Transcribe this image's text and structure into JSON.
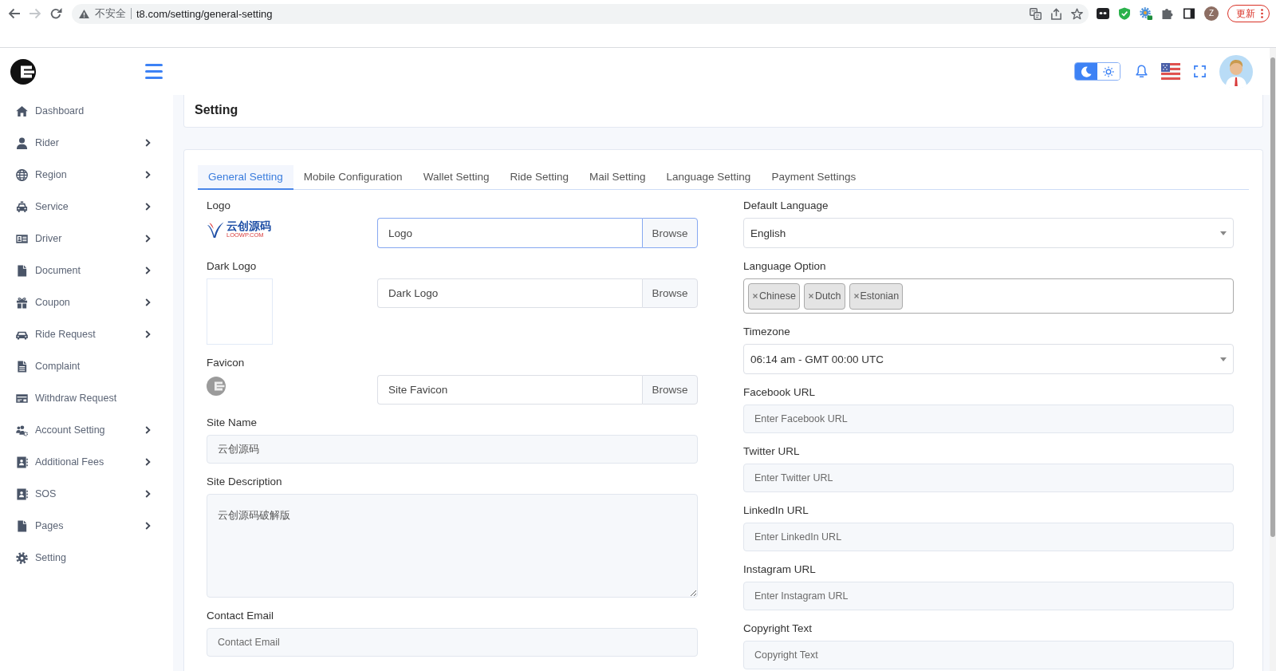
{
  "browser": {
    "nav": [
      {
        "kind": "back",
        "disabled": false
      },
      {
        "kind": "forward",
        "disabled": true
      },
      {
        "kind": "reload",
        "disabled": false
      }
    ],
    "security_label": "不安全",
    "url": "t8.com/setting/general-setting",
    "profile_initial": "Z",
    "update_button": "更新"
  },
  "header": {
    "theme_toggle": [
      {
        "kind": "dark",
        "selected": true
      },
      {
        "kind": "light",
        "selected": false
      }
    ]
  },
  "sidebar": {
    "items": [
      {
        "label": "Dashboard",
        "expandable": false
      },
      {
        "label": "Rider",
        "expandable": true
      },
      {
        "label": "Region",
        "expandable": true
      },
      {
        "label": "Service",
        "expandable": true
      },
      {
        "label": "Driver",
        "expandable": true
      },
      {
        "label": "Document",
        "expandable": true
      },
      {
        "label": "Coupon",
        "expandable": true
      },
      {
        "label": "Ride Request",
        "expandable": true
      },
      {
        "label": "Complaint",
        "expandable": false
      },
      {
        "label": "Withdraw Request",
        "expandable": false
      },
      {
        "label": "Account Setting",
        "expandable": true
      },
      {
        "label": "Additional Fees",
        "expandable": true
      },
      {
        "label": "SOS",
        "expandable": true
      },
      {
        "label": "Pages",
        "expandable": true
      },
      {
        "label": "Setting",
        "expandable": false
      }
    ]
  },
  "page_title": "Setting",
  "tabs": [
    {
      "label": "General Setting",
      "selected": true
    },
    {
      "label": "Mobile Configuration",
      "selected": false
    },
    {
      "label": "Wallet Setting",
      "selected": false
    },
    {
      "label": "Ride Setting",
      "selected": false
    },
    {
      "label": "Mail Setting",
      "selected": false
    },
    {
      "label": "Language Setting",
      "selected": false
    },
    {
      "label": "Payment Settings",
      "selected": false
    }
  ],
  "form": {
    "left": [
      {
        "kind": "file",
        "label": "Logo",
        "preview": {
          "kind": "brand",
          "name": "云创源码",
          "domain": "LOOWP.COM"
        },
        "placeholder": "Logo",
        "button": "Browse",
        "focused": true
      },
      {
        "kind": "file",
        "label": "Dark Logo",
        "preview": {
          "kind": "blank"
        },
        "placeholder": "Dark Logo",
        "button": "Browse",
        "focused": false
      },
      {
        "kind": "file",
        "label": "Favicon",
        "preview": {
          "kind": "mark"
        },
        "placeholder": "Site Favicon",
        "button": "Browse",
        "focused": false
      },
      {
        "kind": "text",
        "label": "Site Name",
        "value": "云创源码",
        "focused": false
      },
      {
        "kind": "textarea",
        "label": "Site Description",
        "value": "云创源码破解版",
        "focused": false
      },
      {
        "kind": "text",
        "label": "Contact Email",
        "placeholder": "Contact Email",
        "focused": false
      }
    ],
    "right": [
      {
        "kind": "select",
        "label": "Default Language",
        "value": "English",
        "focused": false
      },
      {
        "kind": "multiselect",
        "label": "Language Option",
        "tags": [
          "Chinese",
          "Dutch",
          "Estonian"
        ],
        "focused": false
      },
      {
        "kind": "select",
        "label": "Timezone",
        "value": "06:14 am - GMT 00:00 UTC",
        "focused": false
      },
      {
        "kind": "text",
        "label": "Facebook URL",
        "placeholder": "Enter Facebook URL",
        "focused": false
      },
      {
        "kind": "text",
        "label": "Twitter URL",
        "placeholder": "Enter Twitter URL",
        "focused": false
      },
      {
        "kind": "text",
        "label": "LinkedIn URL",
        "placeholder": "Enter LinkedIn URL",
        "focused": false
      },
      {
        "kind": "text",
        "label": "Instagram URL",
        "placeholder": "Enter Instagram URL",
        "focused": false
      },
      {
        "kind": "text",
        "label": "Copyright Text",
        "placeholder": "Copyright Text",
        "focused": false
      }
    ]
  }
}
